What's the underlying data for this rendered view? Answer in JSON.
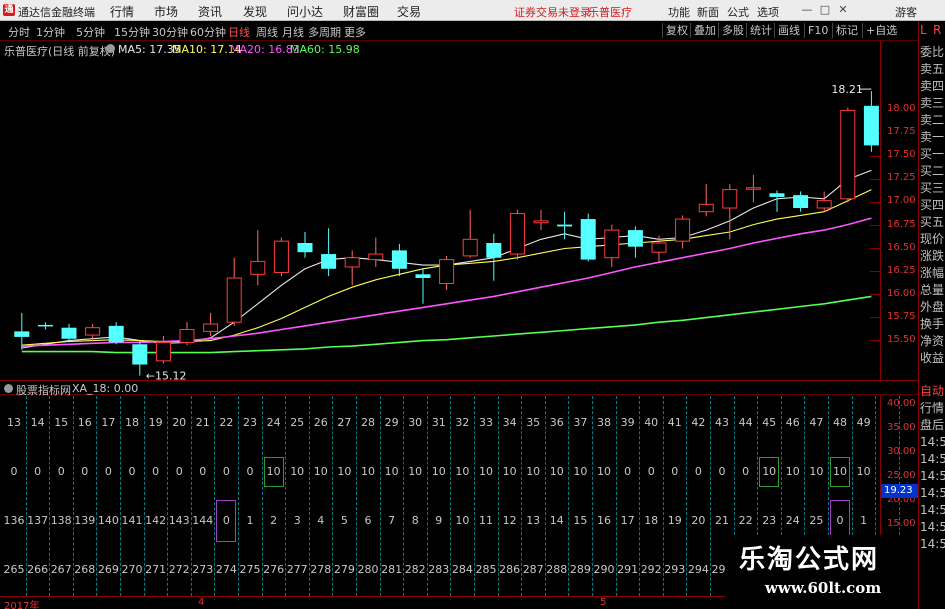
{
  "app": {
    "title": "通达信金融终端",
    "logo_text": "通"
  },
  "menu": [
    "行情",
    "市场",
    "资讯",
    "发现",
    "问小达",
    "财富圈",
    "交易"
  ],
  "warning": "证券交易未登录",
  "stock_name_top": "乐普医疗",
  "right_menu": [
    "功能",
    "新面",
    "公式",
    "选项"
  ],
  "guest": "游客",
  "window_buttons": [
    "—",
    "□",
    "✕"
  ],
  "periods": [
    "分时",
    "1分钟",
    "5分钟",
    "15分钟",
    "30分钟",
    "60分钟",
    "日线",
    "周线",
    "月线",
    "多周期",
    "更多"
  ],
  "active_period": "日线",
  "toolbar": [
    "复权",
    "叠加",
    "多股",
    "统计",
    "画线",
    "F10",
    "标记",
    "+自选"
  ],
  "chart_info": {
    "title": "乐普医疗(日线 前复权)",
    "ma5": "MA5: 17.35",
    "ma10": "MA10: 17.14",
    "ma20": "MA20: 16.83",
    "ma60": "MA60: 15.98"
  },
  "subchart_info": {
    "name": "股票指标网",
    "indicator": "XA_18: 0.00"
  },
  "colors": {
    "up": "#ff3c3c",
    "down": "#54ffff",
    "ma5": "#e8e8e8",
    "ma10": "#ffff55",
    "ma20": "#ff55ff",
    "ma60": "#55ff55",
    "box_green": "#2e9a2e",
    "box_purple": "#a040c0"
  },
  "right_panel_top": [
    "L",
    "R"
  ],
  "right_panel": [
    "委比",
    "卖五",
    "卖四",
    "卖三",
    "卖二",
    "卖一",
    "买一",
    "买二",
    "买三",
    "买四",
    "买五",
    "现价",
    "涨跌",
    "涨幅",
    "总量",
    "外盘",
    "换手",
    "净资",
    "收益"
  ],
  "right_panel_bottom": [
    {
      "label": "自动",
      "color": "#ff4040"
    },
    {
      "label": "行情",
      "color": "#c0c0c0"
    },
    {
      "label": "盘后",
      "color": "#c0c0c0"
    },
    {
      "label": "14:50",
      "color": "#c0c0c0"
    },
    {
      "label": "14:50",
      "color": "#c0c0c0"
    },
    {
      "label": "14:50",
      "color": "#c0c0c0"
    },
    {
      "label": "14:50",
      "color": "#c0c0c0"
    },
    {
      "label": "14:50",
      "color": "#c0c0c0"
    },
    {
      "label": "14:50",
      "color": "#c0c0c0"
    },
    {
      "label": "14:50",
      "color": "#c0c0c0"
    }
  ],
  "watermark": {
    "line1": "乐淘公式网",
    "line2": "www.60lt.com"
  },
  "date_labels": [
    "2017年",
    "4",
    "5"
  ],
  "chart_data": {
    "type": "candlestick",
    "y_ticks": [
      "18.00",
      "17.75",
      "17.50",
      "17.25",
      "17.00",
      "16.75",
      "16.50",
      "16.25",
      "16.00",
      "15.75",
      "15.50"
    ],
    "y_range": [
      15.3,
      18.45
    ],
    "annotations": {
      "max": "18.21",
      "min": "15.12"
    },
    "candles": [
      {
        "o": 15.6,
        "c": 15.54,
        "h": 15.8,
        "l": 15.4
      },
      {
        "o": 15.67,
        "c": 15.66,
        "h": 15.7,
        "l": 15.62
      },
      {
        "o": 15.64,
        "c": 15.52,
        "h": 15.68,
        "l": 15.48
      },
      {
        "o": 15.56,
        "c": 15.64,
        "h": 15.68,
        "l": 15.5
      },
      {
        "o": 15.66,
        "c": 15.48,
        "h": 15.7,
        "l": 15.46
      },
      {
        "o": 15.46,
        "c": 15.24,
        "h": 15.5,
        "l": 15.12
      },
      {
        "o": 15.28,
        "c": 15.48,
        "h": 15.55,
        "l": 15.25
      },
      {
        "o": 15.48,
        "c": 15.62,
        "h": 15.7,
        "l": 15.45
      },
      {
        "o": 15.6,
        "c": 15.68,
        "h": 15.8,
        "l": 15.55
      },
      {
        "o": 15.7,
        "c": 16.18,
        "h": 16.4,
        "l": 15.66
      },
      {
        "o": 16.22,
        "c": 16.36,
        "h": 16.7,
        "l": 16.1
      },
      {
        "o": 16.24,
        "c": 16.58,
        "h": 16.62,
        "l": 16.2
      },
      {
        "o": 16.56,
        "c": 16.46,
        "h": 16.68,
        "l": 16.4
      },
      {
        "o": 16.44,
        "c": 16.28,
        "h": 16.72,
        "l": 16.2
      },
      {
        "o": 16.3,
        "c": 16.4,
        "h": 16.48,
        "l": 16.1
      },
      {
        "o": 16.38,
        "c": 16.44,
        "h": 16.62,
        "l": 16.3
      },
      {
        "o": 16.48,
        "c": 16.28,
        "h": 16.55,
        "l": 16.2
      },
      {
        "o": 16.22,
        "c": 16.18,
        "h": 16.28,
        "l": 15.9
      },
      {
        "o": 16.12,
        "c": 16.38,
        "h": 16.42,
        "l": 16.05
      },
      {
        "o": 16.42,
        "c": 16.6,
        "h": 16.92,
        "l": 16.4
      },
      {
        "o": 16.56,
        "c": 16.4,
        "h": 16.66,
        "l": 16.15
      },
      {
        "o": 16.44,
        "c": 16.88,
        "h": 16.92,
        "l": 16.38
      },
      {
        "o": 16.78,
        "c": 16.8,
        "h": 16.92,
        "l": 16.7
      },
      {
        "o": 16.76,
        "c": 16.74,
        "h": 16.9,
        "l": 16.6
      },
      {
        "o": 16.82,
        "c": 16.38,
        "h": 16.88,
        "l": 16.36
      },
      {
        "o": 16.4,
        "c": 16.7,
        "h": 16.76,
        "l": 16.3
      },
      {
        "o": 16.7,
        "c": 16.52,
        "h": 16.74,
        "l": 16.4
      },
      {
        "o": 16.46,
        "c": 16.56,
        "h": 16.64,
        "l": 16.35
      },
      {
        "o": 16.58,
        "c": 16.82,
        "h": 16.86,
        "l": 16.5
      },
      {
        "o": 16.9,
        "c": 16.98,
        "h": 17.2,
        "l": 16.85
      },
      {
        "o": 16.94,
        "c": 17.14,
        "h": 17.2,
        "l": 16.6
      },
      {
        "o": 17.16,
        "c": 17.16,
        "h": 17.3,
        "l": 17.0
      },
      {
        "o": 17.1,
        "c": 17.06,
        "h": 17.13,
        "l": 16.9
      },
      {
        "o": 17.08,
        "c": 16.94,
        "h": 17.12,
        "l": 16.9
      },
      {
        "o": 16.94,
        "c": 17.02,
        "h": 17.12,
        "l": 16.9
      },
      {
        "o": 17.04,
        "c": 18.0,
        "h": 18.03,
        "l": 17.0
      },
      {
        "o": 18.05,
        "c": 17.62,
        "h": 18.21,
        "l": 17.55
      }
    ],
    "ma_series": [
      {
        "name": "MA5",
        "values": [
          15.42,
          15.46,
          15.5,
          15.52,
          15.54,
          15.5,
          15.47,
          15.48,
          15.53,
          15.7,
          15.9,
          16.1,
          16.28,
          16.38,
          16.4,
          16.38,
          16.35,
          16.32,
          16.32,
          16.36,
          16.4,
          16.5,
          16.6,
          16.66,
          16.6,
          16.62,
          16.64,
          16.6,
          16.62,
          16.7,
          16.8,
          16.94,
          17.04,
          17.06,
          17.04,
          17.25,
          17.35
        ]
      },
      {
        "name": "MA10",
        "values": [
          15.45,
          15.47,
          15.49,
          15.5,
          15.51,
          15.5,
          15.49,
          15.49,
          15.5,
          15.56,
          15.64,
          15.74,
          15.86,
          15.98,
          16.08,
          16.16,
          16.22,
          16.28,
          16.32,
          16.34,
          16.36,
          16.4,
          16.45,
          16.5,
          16.52,
          16.54,
          16.56,
          16.58,
          16.6,
          16.64,
          16.68,
          16.76,
          16.82,
          16.86,
          16.9,
          17.02,
          17.14
        ]
      },
      {
        "name": "MA20",
        "values": [
          15.44,
          15.45,
          15.46,
          15.47,
          15.48,
          15.48,
          15.49,
          15.5,
          15.52,
          15.55,
          15.58,
          15.62,
          15.66,
          15.7,
          15.74,
          15.78,
          15.82,
          15.86,
          15.9,
          15.94,
          15.98,
          16.03,
          16.08,
          16.13,
          16.18,
          16.24,
          16.3,
          16.35,
          16.4,
          16.45,
          16.5,
          16.56,
          16.61,
          16.66,
          16.7,
          16.76,
          16.83
        ]
      },
      {
        "name": "MA60",
        "values": [
          15.38,
          15.38,
          15.38,
          15.38,
          15.37,
          15.37,
          15.37,
          15.37,
          15.37,
          15.38,
          15.39,
          15.4,
          15.41,
          15.43,
          15.44,
          15.46,
          15.48,
          15.5,
          15.51,
          15.53,
          15.55,
          15.57,
          15.59,
          15.61,
          15.63,
          15.65,
          15.67,
          15.7,
          15.72,
          15.75,
          15.78,
          15.81,
          15.84,
          15.87,
          15.9,
          15.94,
          15.98
        ]
      }
    ]
  },
  "grid": {
    "row1": [
      "13",
      "14",
      "15",
      "16",
      "17",
      "18",
      "19",
      "20",
      "21",
      "22",
      "23",
      "24",
      "25",
      "26",
      "27",
      "28",
      "29",
      "30",
      "31",
      "32",
      "33",
      "34",
      "35",
      "36",
      "37",
      "38",
      "39",
      "40",
      "41",
      "42",
      "43",
      "44",
      "45",
      "46",
      "47",
      "48",
      "49"
    ],
    "row2": [
      "0",
      "0",
      "0",
      "0",
      "0",
      "0",
      "0",
      "0",
      "0",
      "0",
      "0",
      "10",
      "10",
      "10",
      "10",
      "10",
      "10",
      "10",
      "10",
      "10",
      "10",
      "10",
      "10",
      "10",
      "10",
      "10",
      "0",
      "0",
      "0",
      "0",
      "0",
      "0",
      "10",
      "10",
      "10",
      "10",
      "10"
    ],
    "row3": [
      "136",
      "137",
      "138",
      "139",
      "140",
      "141",
      "142",
      "143",
      "144",
      "0",
      "1",
      "2",
      "3",
      "4",
      "5",
      "6",
      "7",
      "8",
      "9",
      "10",
      "11",
      "12",
      "13",
      "14",
      "15",
      "16",
      "17",
      "18",
      "19",
      "20",
      "21",
      "22",
      "23",
      "24",
      "25",
      "0",
      "1"
    ],
    "row4": [
      "265",
      "266",
      "267",
      "268",
      "269",
      "270",
      "271",
      "272",
      "273",
      "274",
      "275",
      "276",
      "277",
      "278",
      "279",
      "280",
      "281",
      "282",
      "283",
      "284",
      "285",
      "286",
      "287",
      "288",
      "289",
      "290",
      "291",
      "292",
      "293",
      "294",
      "295",
      "296",
      "297",
      "298",
      "299",
      "300",
      "301"
    ],
    "green_boxes": [
      11,
      32,
      35
    ],
    "purple_boxes": [
      9,
      35
    ]
  },
  "sub_y_ticks": [
    "40.00",
    "35.00",
    "30.00",
    "25.00",
    "20.00",
    "15.00",
    "10.00"
  ],
  "sub_value": "19.23"
}
